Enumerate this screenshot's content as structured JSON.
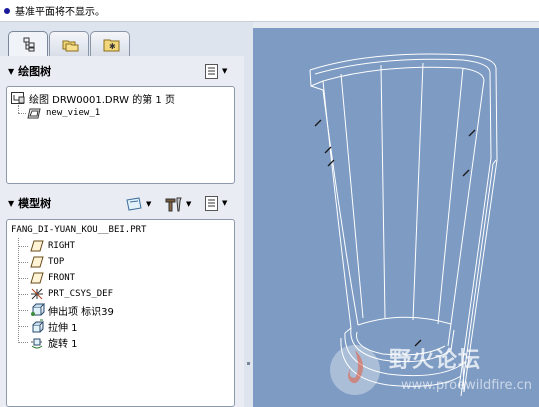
{
  "status": {
    "message": "基准平面将不显示。"
  },
  "tabs": [
    {
      "name": "model-tree-tab",
      "icon": "tree-hierarchy-icon",
      "active": true
    },
    {
      "name": "folder-browser-tab",
      "icon": "folders-icon",
      "active": false
    },
    {
      "name": "favorites-tab",
      "icon": "favorites-icon",
      "active": false
    }
  ],
  "drawing_tree": {
    "title": "绘图树",
    "root_label": "绘图 DRW0001.DRW 的第 1 页",
    "child_label": "new_view_1"
  },
  "model_tree": {
    "title": "模型树",
    "root_label": "FANG_DI-YUAN_KOU__BEI.PRT",
    "items": [
      {
        "label": "RIGHT",
        "icon": "datum-plane-icon"
      },
      {
        "label": "TOP",
        "icon": "datum-plane-icon"
      },
      {
        "label": "FRONT",
        "icon": "datum-plane-icon"
      },
      {
        "label": "PRT_CSYS_DEF",
        "icon": "coordinate-system-icon"
      },
      {
        "label": "伸出项 标识39",
        "icon": "protrusion-icon"
      },
      {
        "label": "拉伸 1",
        "icon": "extrude-icon"
      },
      {
        "label": "旋转 1",
        "icon": "revolve-icon"
      }
    ]
  },
  "watermark": {
    "title": "野火论坛",
    "url": "www.proewildfire.cn"
  }
}
